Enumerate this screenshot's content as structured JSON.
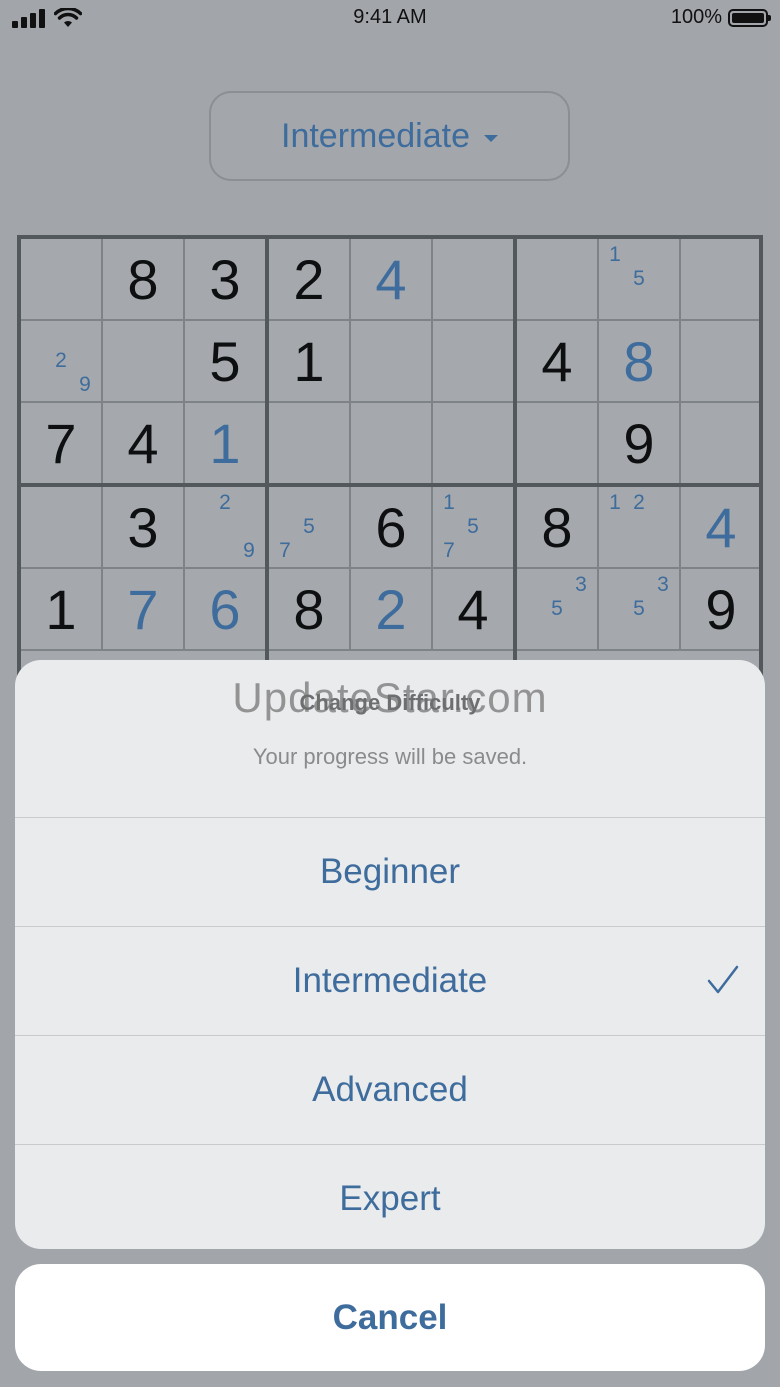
{
  "status_bar": {
    "time": "9:41 AM",
    "battery": "100%"
  },
  "difficulty_button": {
    "label": "Intermediate"
  },
  "board": {
    "rows": [
      [
        {
          "v": ""
        },
        {
          "v": "8"
        },
        {
          "v": "3"
        },
        {
          "v": "2"
        },
        {
          "v": "4",
          "user": true
        },
        {
          "v": ""
        },
        {
          "v": ""
        },
        {
          "v": "",
          "notes": [
            "1",
            "",
            "",
            "",
            "5",
            "",
            "",
            "",
            ""
          ]
        },
        {
          "v": ""
        }
      ],
      [
        {
          "v": "",
          "notes": [
            "",
            "",
            "",
            "",
            "2",
            "",
            "",
            "",
            "9"
          ]
        },
        {
          "v": ""
        },
        {
          "v": "5"
        },
        {
          "v": "1"
        },
        {
          "v": ""
        },
        {
          "v": ""
        },
        {
          "v": "4"
        },
        {
          "v": "8",
          "user": true
        },
        {
          "v": ""
        }
      ],
      [
        {
          "v": "7"
        },
        {
          "v": "4"
        },
        {
          "v": "1",
          "user": true
        },
        {
          "v": ""
        },
        {
          "v": ""
        },
        {
          "v": ""
        },
        {
          "v": ""
        },
        {
          "v": "9"
        },
        {
          "v": ""
        }
      ],
      [
        {
          "v": ""
        },
        {
          "v": "3"
        },
        {
          "v": "",
          "notes": [
            "",
            "2",
            "",
            "",
            "",
            "",
            "",
            "",
            "9"
          ]
        },
        {
          "v": "",
          "notes": [
            "",
            "",
            "",
            "",
            "5",
            "",
            "7",
            "",
            ""
          ]
        },
        {
          "v": "6"
        },
        {
          "v": "",
          "notes": [
            "1",
            "",
            "",
            "",
            "5",
            "",
            "7",
            "",
            ""
          ]
        },
        {
          "v": "8"
        },
        {
          "v": "",
          "notes": [
            "1",
            "2",
            "",
            "",
            "",
            "",
            "",
            "",
            ""
          ]
        },
        {
          "v": "4",
          "user": true
        }
      ],
      [
        {
          "v": "1"
        },
        {
          "v": "7",
          "user": true
        },
        {
          "v": "6",
          "user": true
        },
        {
          "v": "8"
        },
        {
          "v": "2",
          "user": true
        },
        {
          "v": "4"
        },
        {
          "v": "",
          "notes": [
            "",
            "",
            "3",
            "",
            "5",
            "",
            "",
            "",
            ""
          ]
        },
        {
          "v": "",
          "notes": [
            "",
            "",
            "3",
            "",
            "5",
            "",
            "",
            "",
            ""
          ]
        },
        {
          "v": "9"
        }
      ]
    ]
  },
  "action_sheet": {
    "title": "Change Difficulty",
    "watermark": "UpdateStar.com",
    "message": "Your progress will be saved.",
    "options": [
      {
        "label": "Beginner",
        "selected": false
      },
      {
        "label": "Intermediate",
        "selected": true
      },
      {
        "label": "Advanced",
        "selected": false
      },
      {
        "label": "Expert",
        "selected": false
      }
    ],
    "cancel_label": "Cancel"
  },
  "colors": {
    "accent": "#3e6c9c",
    "dim_background": "#a2a6ab",
    "sheet": "#eaebed"
  }
}
